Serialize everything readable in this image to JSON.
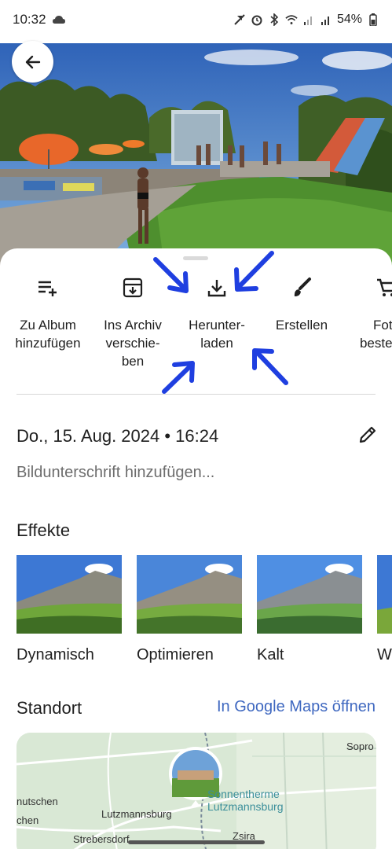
{
  "status_bar": {
    "time": "10:32",
    "battery": "54%",
    "icons": [
      "cloud-icon",
      "mute-icon",
      "alarm-icon",
      "bluetooth-icon",
      "wifi-icon",
      "signal-icon",
      "signal-icon",
      "battery-icon"
    ]
  },
  "photo": {
    "description_icon": "photo-waterpark"
  },
  "actions": [
    {
      "label": "Zu Album\nhinzufügen",
      "icon": "playlist-add-icon"
    },
    {
      "label": "Ins Archiv\nverschie-\nben",
      "icon": "archive-icon"
    },
    {
      "label": "Herunter-\nladen",
      "icon": "download-icon"
    },
    {
      "label": "Erstellen",
      "icon": "brush-icon"
    },
    {
      "label": "Foto\nbestellen",
      "icon": "cart-icon"
    }
  ],
  "details": {
    "date": "Do., 15. Aug. 2024  •  16:24",
    "caption_placeholder": "Bildunterschrift hinzufügen..."
  },
  "effects": {
    "title": "Effekte",
    "items": [
      {
        "label": "Dynamisch"
      },
      {
        "label": "Optimieren"
      },
      {
        "label": "Kalt"
      },
      {
        "label": "W"
      }
    ]
  },
  "location": {
    "title": "Standort",
    "maps_link": "In Google Maps öffnen",
    "map_labels": {
      "sopron": "Sopro",
      "sonnentherme_1": "Sonnentherme",
      "sonnentherme_2": "Lutzmannsburg",
      "lutzmannsburg": "Lutzmannsburg",
      "nutschen": "nutschen",
      "chen": "chen",
      "strebersdorf": "Strebersdorf",
      "zsira": "Zsira"
    }
  },
  "colors": {
    "accent": "#3f68c0",
    "annotation": "#1f3fe0"
  }
}
